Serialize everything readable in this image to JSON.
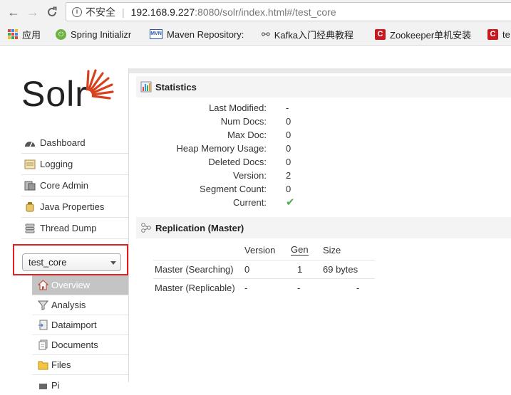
{
  "browser": {
    "back_glyph": "←",
    "forward_glyph": "→",
    "reload_glyph": "C",
    "info_glyph": "i",
    "insecure_label": "不安全",
    "separator": "|",
    "url_host": "192.168.9.227",
    "url_path": ":8080/solr/index.html#/test_core"
  },
  "bookmarks": [
    {
      "label": "应用",
      "icon": "apps-grid-icon"
    },
    {
      "label": "Spring Initializr",
      "icon": "spring-icon",
      "glyph": "⏻"
    },
    {
      "label": "Maven Repository:",
      "icon": "maven-icon",
      "glyph": "MVN"
    },
    {
      "label": "Kafka入门经典教程",
      "icon": "kafka-icon",
      "glyph": "⚯"
    },
    {
      "label": "Zookeeper单机安装",
      "icon": "csdn-icon",
      "glyph": "C"
    },
    {
      "label": "te",
      "icon": "csdn-icon",
      "glyph": "C"
    }
  ],
  "logo": {
    "text": "Solr"
  },
  "nav": [
    {
      "label": "Dashboard",
      "icon": "dashboard-icon"
    },
    {
      "label": "Logging",
      "icon": "logging-icon"
    },
    {
      "label": "Core Admin",
      "icon": "core-admin-icon"
    },
    {
      "label": "Java Properties",
      "icon": "java-icon"
    },
    {
      "label": "Thread Dump",
      "icon": "thread-dump-icon"
    }
  ],
  "core_selector": {
    "value": "test_core"
  },
  "core_menu": [
    {
      "label": "Overview",
      "icon": "home-icon",
      "active": true
    },
    {
      "label": "Analysis",
      "icon": "funnel-icon"
    },
    {
      "label": "Dataimport",
      "icon": "dataimport-icon"
    },
    {
      "label": "Documents",
      "icon": "documents-icon"
    },
    {
      "label": "Files",
      "icon": "files-icon"
    },
    {
      "label": "Pi",
      "icon": "ping-icon"
    }
  ],
  "statistics": {
    "title": "Statistics",
    "rows": [
      {
        "label": "Last Modified:",
        "value": "-"
      },
      {
        "label": "Num Docs:",
        "value": "0"
      },
      {
        "label": "Max Doc:",
        "value": "0"
      },
      {
        "label": "Heap Memory Usage:",
        "value": "0"
      },
      {
        "label": "Deleted Docs:",
        "value": "0"
      },
      {
        "label": "Version:",
        "value": "2"
      },
      {
        "label": "Segment Count:",
        "value": "0"
      },
      {
        "label": "Current:",
        "value": "✔"
      }
    ]
  },
  "replication": {
    "title": "Replication (Master)",
    "headers": {
      "version": "Version",
      "gen": "Gen",
      "size": "Size"
    },
    "rows": [
      {
        "name": "Master (Searching)",
        "version": "0",
        "gen": "1",
        "size": "69 bytes"
      },
      {
        "name": "Master (Replicable)",
        "version": "-",
        "gen": "-",
        "size": "-"
      }
    ]
  },
  "colors": {
    "solr_accent": "#d9411e",
    "current_check": "#4caf50",
    "highlight_box": "#e02020"
  }
}
